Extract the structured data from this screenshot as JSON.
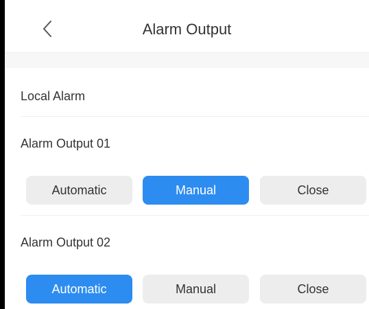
{
  "header": {
    "title": "Alarm Output",
    "back_icon": "chevron-left-icon"
  },
  "local_alarm": {
    "label": "Local Alarm"
  },
  "outputs": [
    {
      "label": "Alarm Output 01",
      "options": [
        "Automatic",
        "Manual",
        "Close"
      ],
      "selected": "Manual"
    },
    {
      "label": "Alarm Output 02",
      "options": [
        "Automatic",
        "Manual",
        "Close"
      ],
      "selected": "Automatic"
    }
  ],
  "colors": {
    "accent": "#2d8cf0",
    "inactive_button": "#ededed",
    "text": "#333333"
  }
}
